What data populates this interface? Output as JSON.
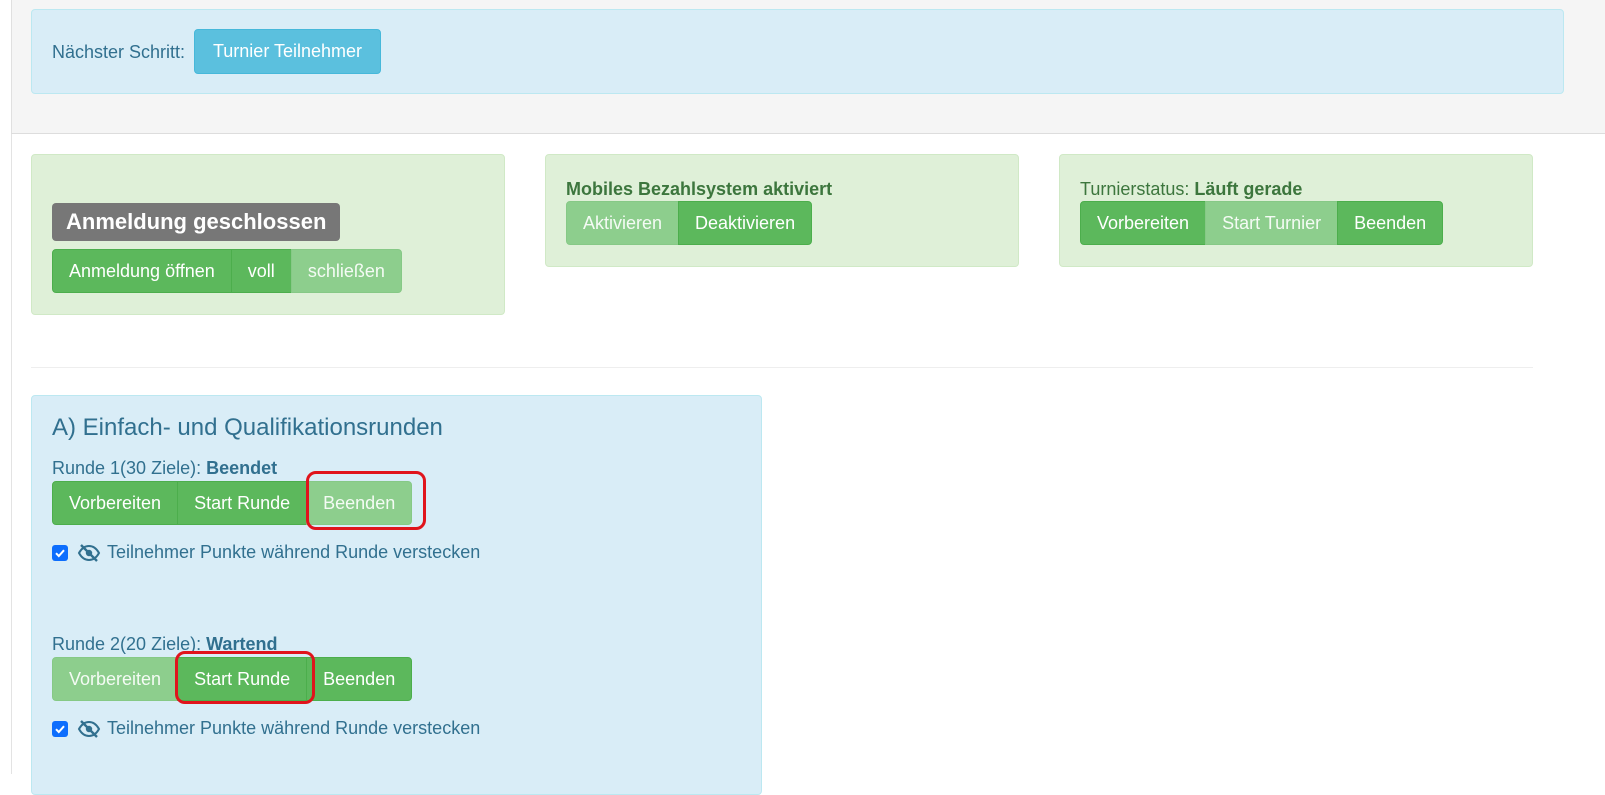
{
  "next_step": {
    "label": "Nächster Schritt:",
    "button": "Turnier Teilnehmer"
  },
  "registration": {
    "status": "Anmeldung geschlossen",
    "buttons": [
      "Anmeldung öffnen",
      "voll",
      "schließen"
    ]
  },
  "payment": {
    "title": "Mobiles Bezahlsystem aktiviert",
    "buttons": [
      "Aktivieren",
      "Deaktivieren"
    ]
  },
  "tournament": {
    "label": "Turnierstatus:",
    "status": "Läuft gerade",
    "buttons": [
      "Vorbereiten",
      "Start Turnier",
      "Beenden"
    ]
  },
  "rounds": {
    "heading": "A) Einfach- und Qualifikationsrunden",
    "items": [
      {
        "label": "Runde 1(30 Ziele):",
        "status": "Beendet",
        "buttons": [
          "Vorbereiten",
          "Start Runde",
          "Beenden"
        ],
        "hide_points": "Teilnehmer Punkte während Runde verstecken",
        "hide_points_checked": true
      },
      {
        "label": "Runde 2(20 Ziele):",
        "status": "Wartend",
        "buttons": [
          "Vorbereiten",
          "Start Runde",
          "Beenden"
        ],
        "hide_points": "Teilnehmer Punkte während Runde verstecken",
        "hide_points_checked": true
      }
    ]
  },
  "colors": {
    "success": "#5cb85c",
    "success_disabled": "#8dce8d",
    "info": "#5bc0de",
    "highlight": "#e0141c"
  }
}
